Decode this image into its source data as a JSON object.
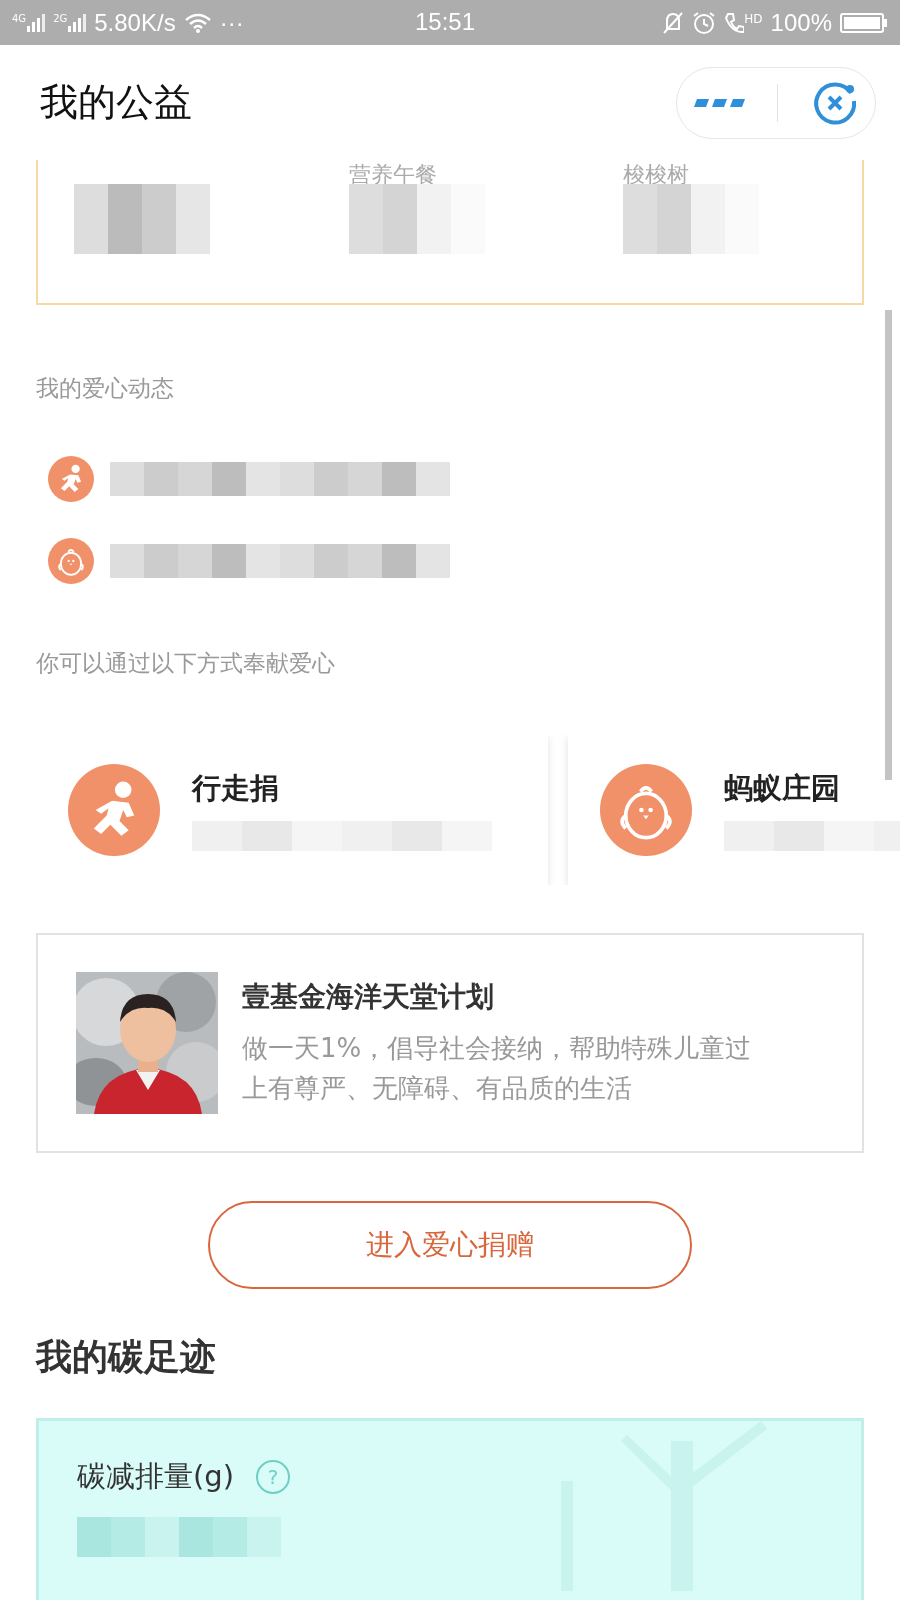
{
  "status_bar": {
    "network_1": "4G",
    "network_2": "2G",
    "speed": "5.80K/s",
    "more": "···",
    "time": "15:51",
    "call_badge": "HD",
    "battery": "100%"
  },
  "header": {
    "title": "我的公益"
  },
  "top_card": {
    "items": [
      {
        "kind": "covered"
      },
      {
        "kind": "text",
        "label": "营养午餐"
      },
      {
        "kind": "text",
        "label": "梭梭树"
      }
    ]
  },
  "activity": {
    "heading": "我的爱心动态",
    "items": [
      {
        "kind": "walk"
      },
      {
        "kind": "chick"
      }
    ]
  },
  "ways": {
    "heading": "你可以通过以下方式奉献爱心",
    "cards": [
      {
        "kind": "walk",
        "title": "行走捐"
      },
      {
        "kind": "chick",
        "title": "蚂蚁庄园"
      }
    ]
  },
  "project": {
    "title": "壹基金海洋天堂计划",
    "description": "做一天1%，倡导社会接纳，帮助特殊儿童过上有尊严、无障碍、有品质的生活"
  },
  "donate_button": "进入爱心捐赠",
  "carbon": {
    "heading": "我的碳足迹",
    "metric_label": "碳减排量(g)",
    "help": "?"
  }
}
